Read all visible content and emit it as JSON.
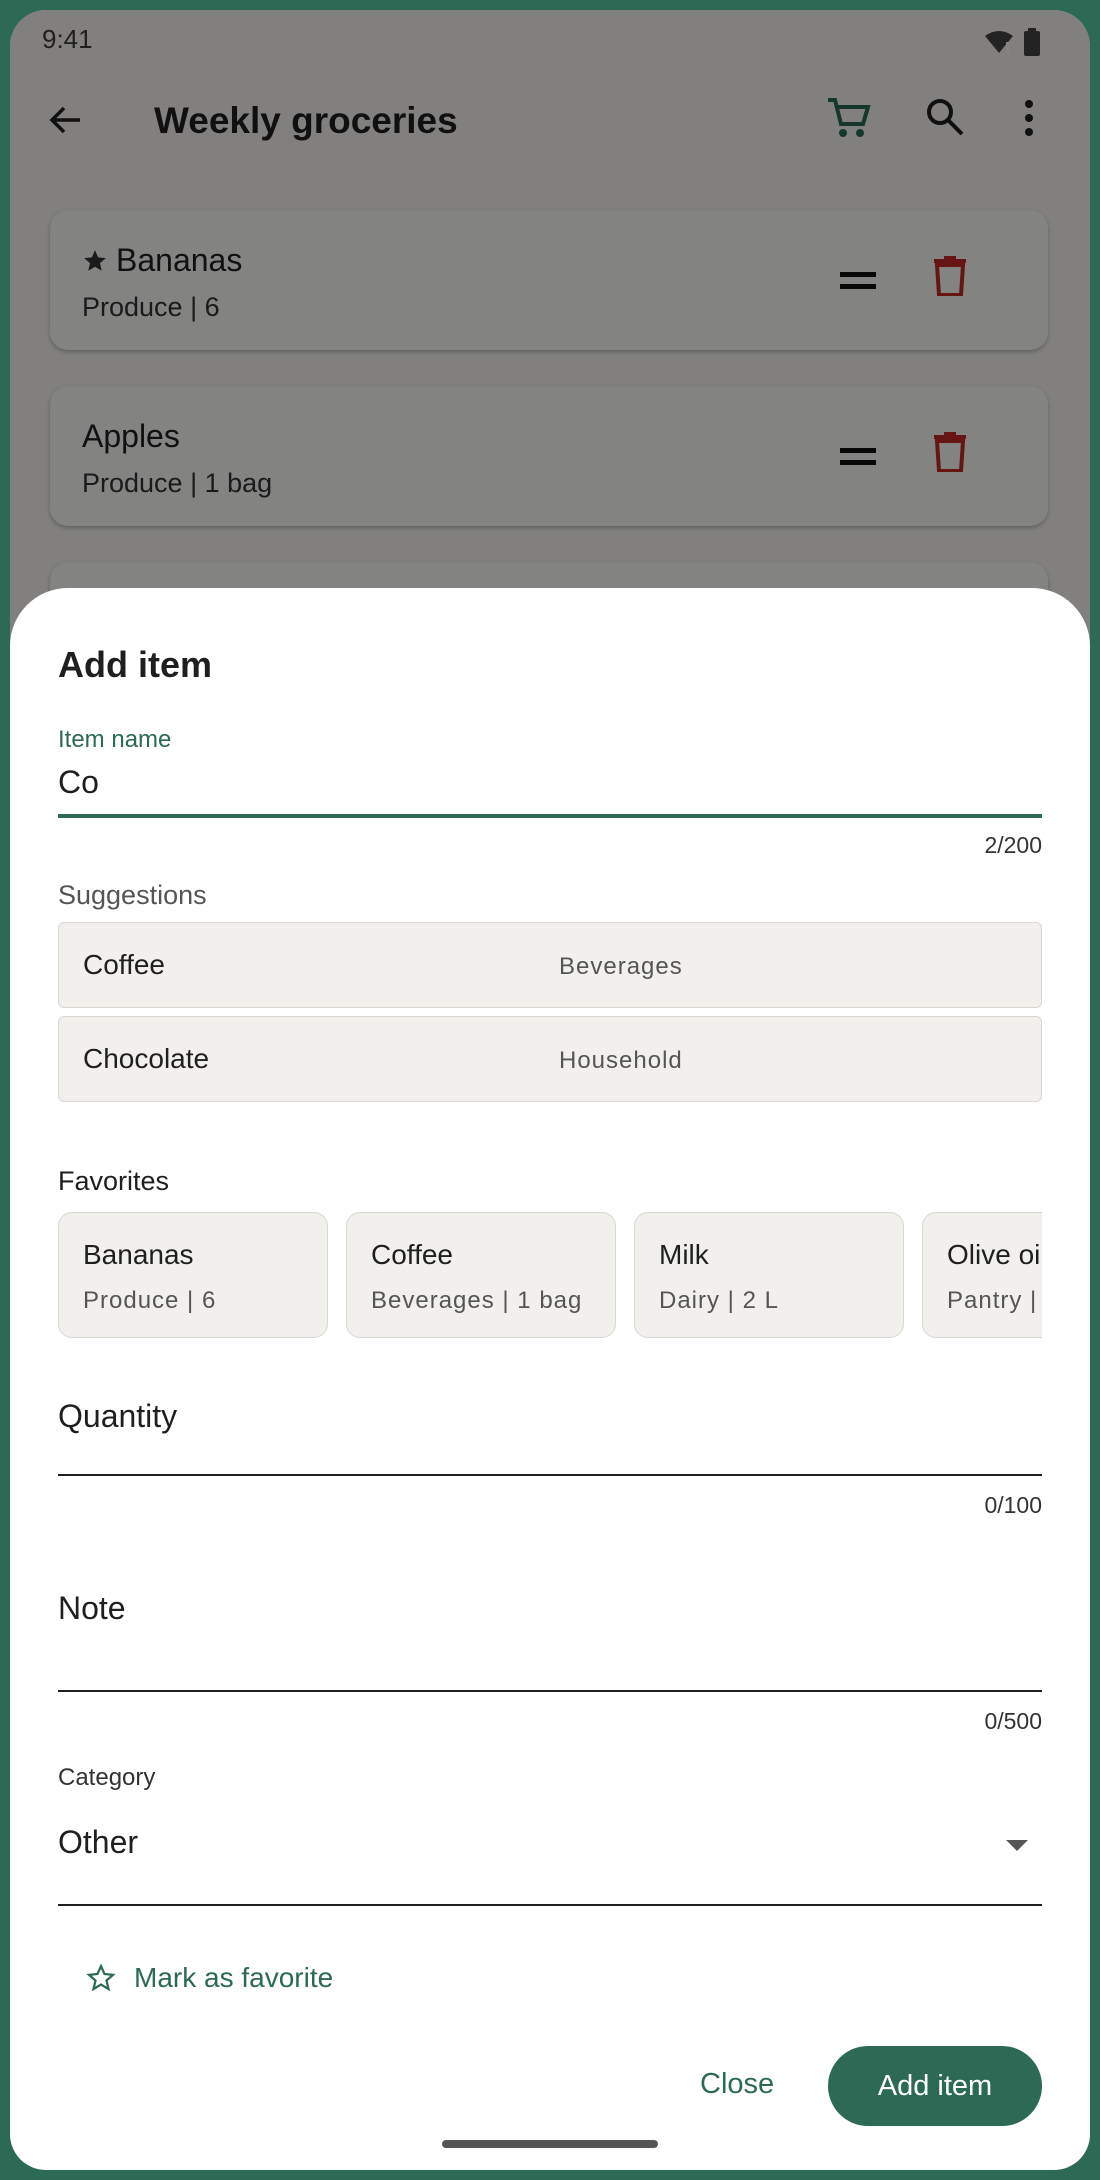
{
  "status_bar": {
    "time": "9:41"
  },
  "app_bar": {
    "title": "Weekly groceries"
  },
  "list_items": [
    {
      "name": "Bananas",
      "meta": "Produce | 6",
      "favorite": true
    },
    {
      "name": "Apples",
      "meta": "Produce | 1 bag",
      "favorite": false
    }
  ],
  "sheet": {
    "title": "Add item",
    "item_name": {
      "label": "Item name",
      "value": "Co",
      "counter": "2/200"
    },
    "suggestions_label": "Suggestions",
    "suggestions": [
      {
        "name": "Coffee",
        "category": "Beverages"
      },
      {
        "name": "Chocolate",
        "category": "Household"
      }
    ],
    "favorites_label": "Favorites",
    "favorites": [
      {
        "name": "Bananas",
        "meta": "Produce | 6"
      },
      {
        "name": "Coffee",
        "meta": "Beverages | 1 bag"
      },
      {
        "name": "Milk",
        "meta": "Dairy | 2 L"
      },
      {
        "name": "Olive oil",
        "meta": "Pantry |"
      }
    ],
    "quantity": {
      "placeholder": "Quantity",
      "counter": "0/100"
    },
    "note": {
      "placeholder": "Note",
      "counter": "0/500"
    },
    "category": {
      "label": "Category",
      "value": "Other"
    },
    "mark_favorite": "Mark as favorite",
    "close_label": "Close",
    "add_label": "Add item"
  },
  "colors": {
    "accent": "#2d6a55",
    "delete": "#c62828",
    "sheet_bg": "#ffffff"
  }
}
